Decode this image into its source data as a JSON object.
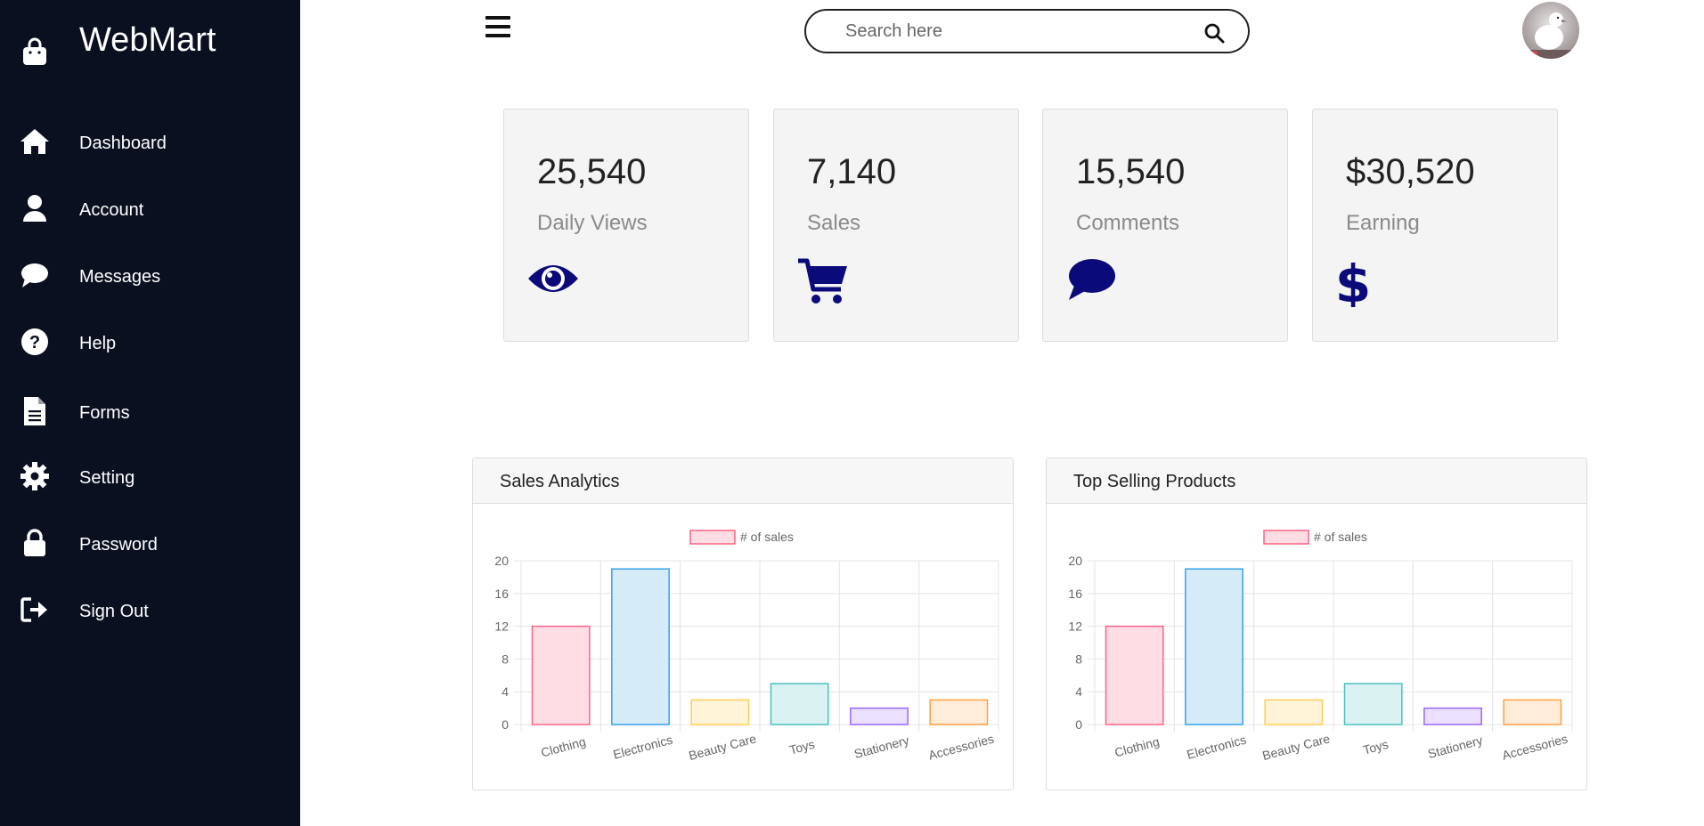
{
  "sidebar": {
    "brand": "WebMart",
    "items": [
      {
        "label": "Dashboard",
        "icon": "home-icon"
      },
      {
        "label": "Account",
        "icon": "user-icon"
      },
      {
        "label": "Messages",
        "icon": "chat-icon"
      },
      {
        "label": "Help",
        "icon": "question-icon"
      },
      {
        "label": "Forms",
        "icon": "document-icon"
      },
      {
        "label": "Setting",
        "icon": "gear-icon"
      },
      {
        "label": "Password",
        "icon": "lock-icon"
      },
      {
        "label": "Sign Out",
        "icon": "sign-out-icon"
      }
    ]
  },
  "search": {
    "placeholder": "Search here"
  },
  "cards": [
    {
      "value": "25,540",
      "label": "Daily Views",
      "icon": "eye-icon"
    },
    {
      "value": "7,140",
      "label": "Sales",
      "icon": "cart-icon"
    },
    {
      "value": "15,540",
      "label": "Comments",
      "icon": "comment-icon"
    },
    {
      "value": "$30,520",
      "label": "Earning",
      "icon": "dollar-icon"
    }
  ],
  "colors": {
    "sidebar": "#0a1020",
    "accent_icon": "#0a0a7a",
    "card_bg": "#f4f4f4"
  },
  "panels": [
    {
      "title": "Sales Analytics"
    },
    {
      "title": "Top Selling Products"
    }
  ],
  "chart_data": [
    {
      "type": "bar",
      "title": "Sales Analytics",
      "categories": [
        "Clothing",
        "Electronics",
        "Beauty Care",
        "Toys",
        "Stationery",
        "Accessories"
      ],
      "series": [
        {
          "name": "# of sales",
          "values": [
            12,
            19,
            3,
            5,
            2,
            3
          ]
        }
      ],
      "ylim": [
        0,
        20
      ],
      "yticks": [
        0,
        4,
        8,
        12,
        16,
        20
      ],
      "grid": true,
      "legend": "top-center",
      "bar_fills": [
        "#ffdde4",
        "#d6ebf8",
        "#fff4d8",
        "#dbf2f2",
        "#ebe0ff",
        "#ffecd9"
      ],
      "bar_strokes": [
        "#ff6384",
        "#36a2eb",
        "#ffce56",
        "#4bc0c0",
        "#9966ff",
        "#ff9f40"
      ]
    },
    {
      "type": "bar",
      "title": "Top Selling Products",
      "categories": [
        "Clothing",
        "Electronics",
        "Beauty Care",
        "Toys",
        "Stationery",
        "Accessories"
      ],
      "series": [
        {
          "name": "# of sales",
          "values": [
            12,
            19,
            3,
            5,
            2,
            3
          ]
        }
      ],
      "ylim": [
        0,
        20
      ],
      "yticks": [
        0,
        4,
        8,
        12,
        16,
        20
      ],
      "grid": true,
      "legend": "top-center",
      "bar_fills": [
        "#ffdde4",
        "#d6ebf8",
        "#fff4d8",
        "#dbf2f2",
        "#ebe0ff",
        "#ffecd9"
      ],
      "bar_strokes": [
        "#ff6384",
        "#36a2eb",
        "#ffce56",
        "#4bc0c0",
        "#9966ff",
        "#ff9f40"
      ]
    }
  ]
}
